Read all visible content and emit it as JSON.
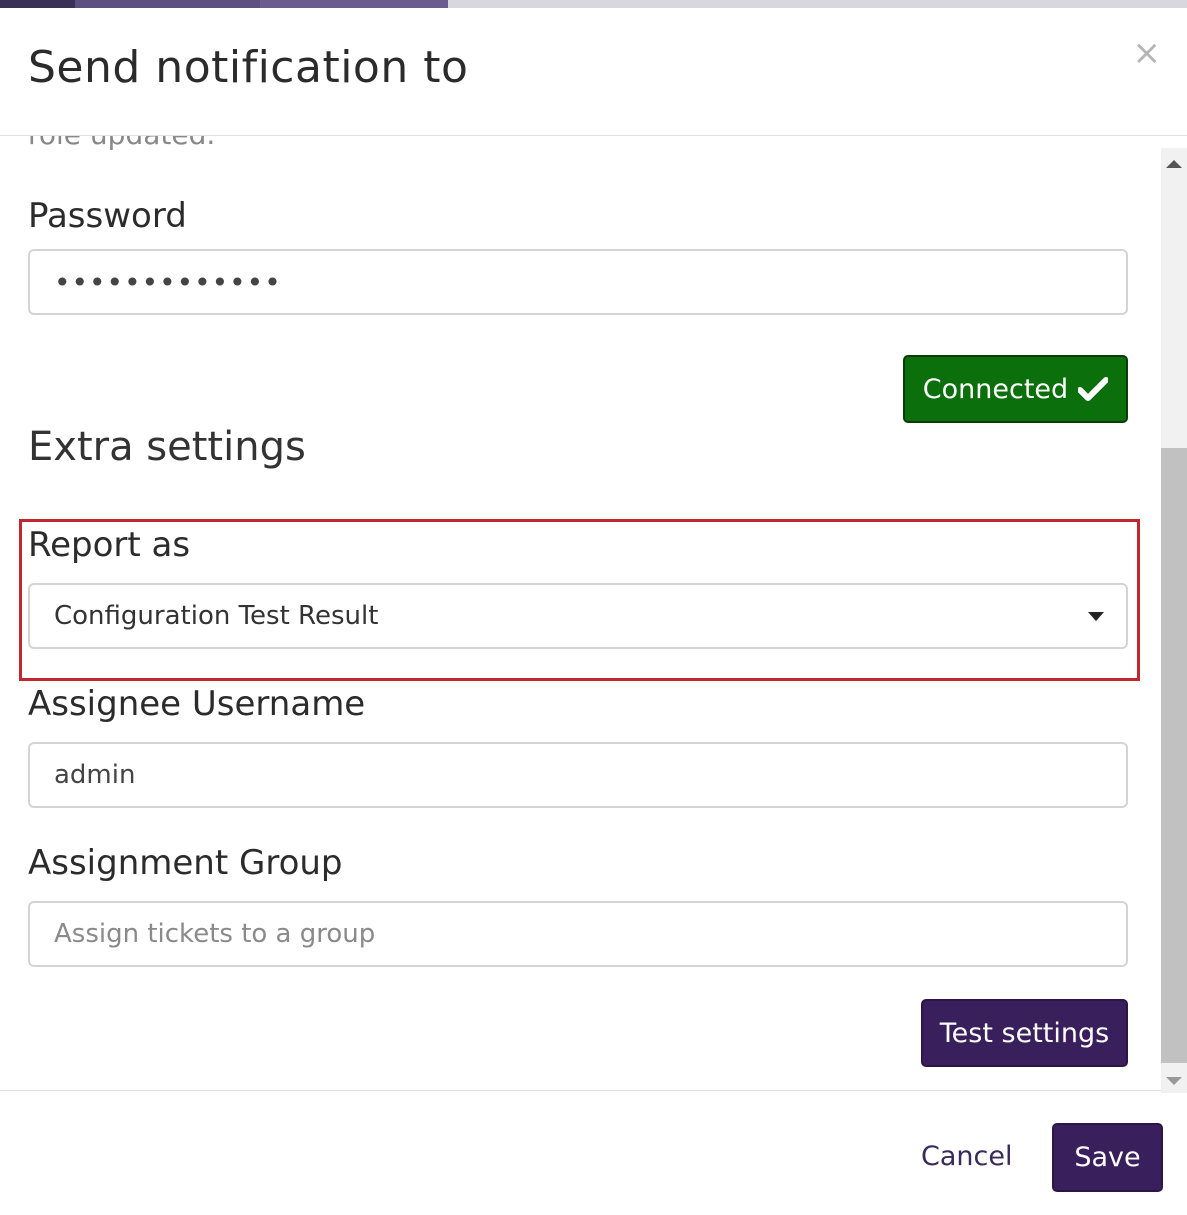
{
  "modal": {
    "title": "Send notification to",
    "close_label": "×"
  },
  "body": {
    "cut_off_text": "role updated.",
    "password": {
      "label": "Password",
      "value": "•••••••••••••"
    },
    "connected_button": {
      "label": "Connected",
      "icon": "checkmark-icon"
    },
    "extra_settings_title": "Extra settings",
    "report_as": {
      "label": "Report as",
      "selected": "Configuration Test Result"
    },
    "assignee": {
      "label": "Assignee Username",
      "value": "admin"
    },
    "assignment_group": {
      "label": "Assignment Group",
      "placeholder": "Assign tickets to a group",
      "value": ""
    },
    "test_button_label": "Test settings"
  },
  "footer": {
    "cancel_label": "Cancel",
    "save_label": "Save"
  },
  "colors": {
    "primary": "#3a1f5d",
    "connected": "#0b6f0b",
    "highlight": "#c1272d"
  }
}
